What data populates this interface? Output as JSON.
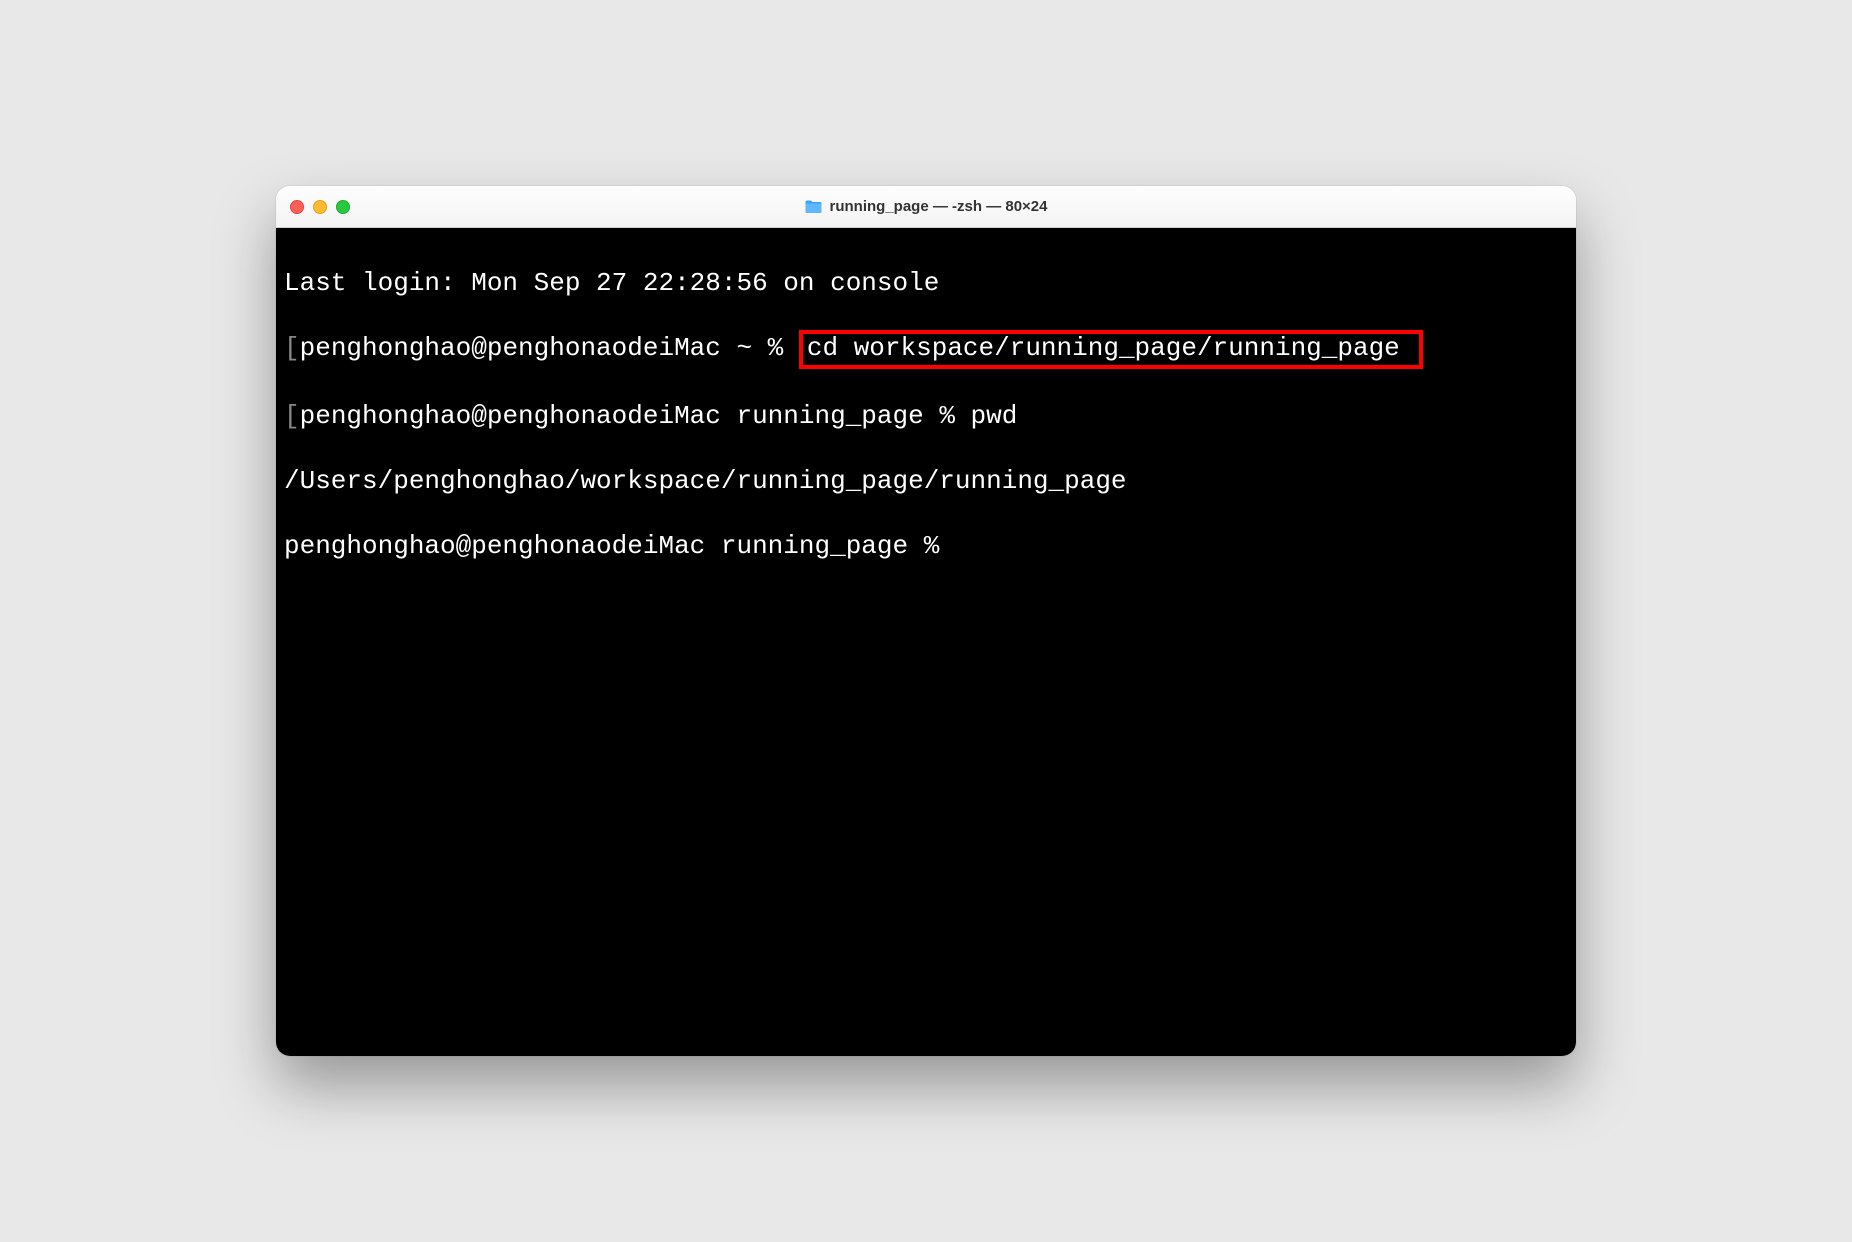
{
  "window": {
    "title": "running_page — -zsh — 80×24",
    "icon": "folder-icon"
  },
  "traffic_lights": {
    "close": "close",
    "minimize": "minimize",
    "maximize": "maximize"
  },
  "terminal": {
    "lines": {
      "line1": "Last login: Mon Sep 27 22:28:56 on console",
      "line2_prompt_bracket": "[",
      "line2_prompt": "penghonghao@penghonaodeiMac ~ % ",
      "line2_cmd": "cd workspace/running_page/running_page ",
      "line2_end_bracket": "]",
      "line3_prompt_bracket": "[",
      "line3_prompt": "penghonghao@penghonaodeiMac running_page % ",
      "line3_cmd": "pwd",
      "line3_end_bracket": "]",
      "line4": "/Users/penghonghao/workspace/running_page/running_page",
      "line5_prompt": "penghonghao@penghonaodeiMac running_page % "
    }
  },
  "highlight": {
    "color": "#ff0000"
  }
}
